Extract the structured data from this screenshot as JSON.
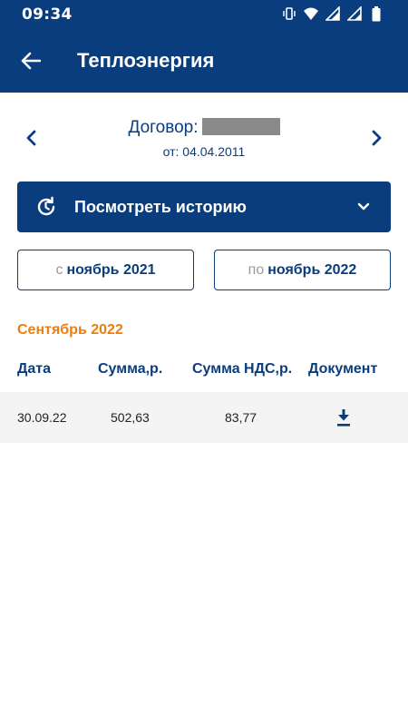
{
  "status_bar": {
    "time": "09:34",
    "icons": [
      "vibrate-icon",
      "wifi-icon",
      "signal-icon",
      "signal-icon",
      "battery-icon"
    ]
  },
  "app_bar": {
    "title": "Теплоэнергия",
    "back_icon": "arrow-left-icon"
  },
  "contract": {
    "label": "Договор:",
    "date_line": "от: 04.04.2011"
  },
  "history_button": {
    "label": "Посмотреть историю",
    "icon": "history-icon",
    "chevron": "chevron-down-icon"
  },
  "date_range": {
    "from_prefix": "с",
    "from_value": "ноябрь 2021",
    "to_prefix": "по",
    "to_value": "ноябрь 2022"
  },
  "section": {
    "month": "Сентябрь 2022",
    "columns": [
      "Дата",
      "Сумма,р.",
      "Сумма НДС,р.",
      "Документ"
    ],
    "rows": [
      {
        "date": "30.09.22",
        "sum": "502,63",
        "vat": "83,77",
        "doc_icon": "download-icon"
      }
    ]
  },
  "colors": {
    "primary": "#0a3d7d",
    "accent": "#f07c0b",
    "row_bg": "#f4f4f4"
  }
}
